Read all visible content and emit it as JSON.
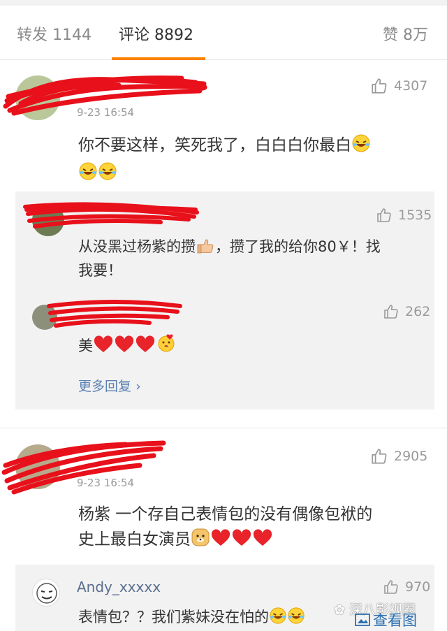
{
  "tabs": [
    {
      "label": "转发 1144"
    },
    {
      "label": "评论 8892"
    },
    {
      "label": "赞 8万"
    }
  ],
  "comments": [
    {
      "time": "9-23 16:54",
      "text_line1": "你不要这样，笑死我了，白白白你最白",
      "likes": "4307",
      "replies": [
        {
          "text_line1": "从没黑过杨紫的攒",
          "text_line1b": "，攒了我的给你80￥！找",
          "text_line2": "我要！",
          "likes": "1535"
        },
        {
          "text": "美",
          "likes": "262"
        }
      ],
      "more_replies": "更多回复"
    },
    {
      "time": "9-23 16:54",
      "text_line1": "杨紫 一个存自己表情包的没有偶像包袱的",
      "text_line2": "史上最白女演员",
      "likes": "2905",
      "replies": [
        {
          "name": "Andy_xxxxx",
          "text": "表情包？？我们紫妹没在怕的",
          "likes": "970"
        }
      ]
    }
  ],
  "watermark": "深八影视圈",
  "view_image_label": "查看图",
  "colors": {
    "accent": "#ff8200",
    "link": "#5b80b2",
    "scribble": "#e8101a"
  }
}
